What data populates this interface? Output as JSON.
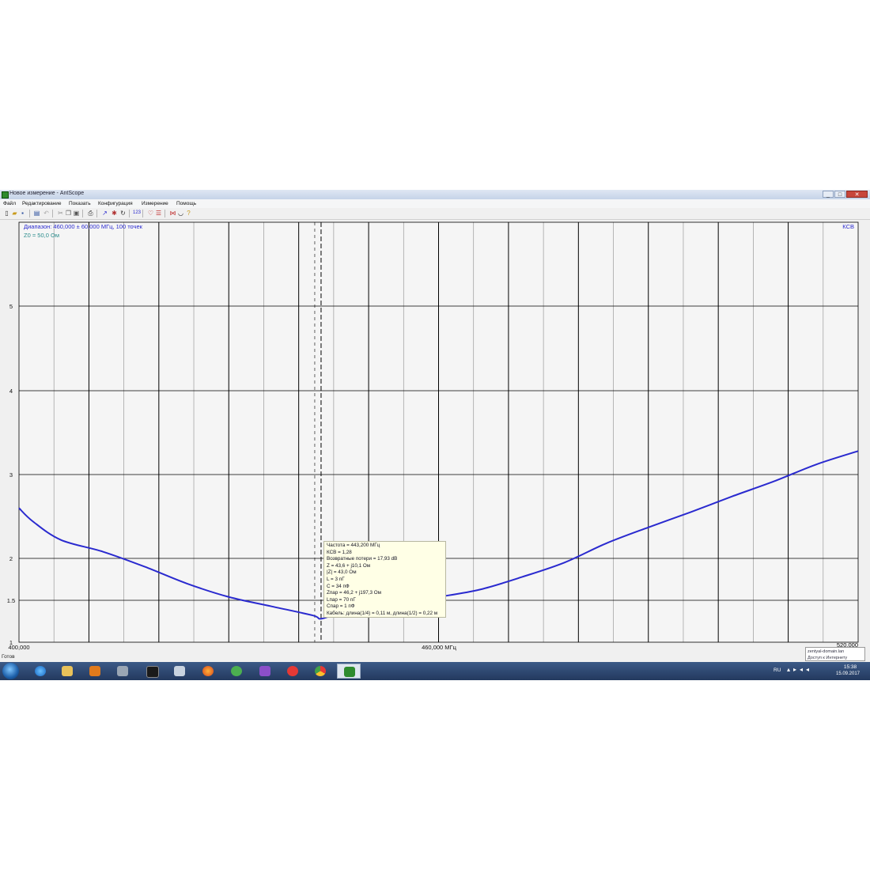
{
  "window": {
    "title": "Новое измерение - AntScope",
    "controls": [
      "_",
      "□",
      "✕"
    ]
  },
  "menu": [
    "Файл",
    "Редактирование",
    "Показать",
    "Конфигурация",
    "Измерение",
    "Помощь"
  ],
  "chart": {
    "range_label": "Диапазон: 460,000 ± 60,000 МГц, 100 точек",
    "z0_label": "Z0 = 50,0 Ом",
    "series_label": "КСВ",
    "x_start_label": "400,000",
    "x_center_label": "460,000 МГц",
    "x_end_label": "520,000",
    "colors": {
      "curve": "#2a2acf",
      "grid_major": "#000000",
      "grid_minor": "#9a9a9a",
      "plot_bg": "#f5f5f5",
      "label_blue": "#2a2acf",
      "label_teal": "#2a8c8c"
    }
  },
  "chart_data": {
    "type": "line",
    "title": "",
    "xlabel": "МГц",
    "ylabel": "",
    "xlim": [
      400,
      520
    ],
    "y_ticks": [
      {
        "label": "1",
        "value": 1
      },
      {
        "label": "1.5",
        "value": 1.5
      },
      {
        "label": "2",
        "value": 2
      },
      {
        "label": "3",
        "value": 3
      },
      {
        "label": "4",
        "value": 4
      },
      {
        "label": "5",
        "value": 5
      }
    ],
    "x_tick_labels": [
      "400,000",
      "460,000 МГц"
    ],
    "series": [
      {
        "name": "КСВ",
        "x": [
          400,
          402,
          406,
          412,
          418,
          424,
          430,
          436,
          442,
          443.2,
          446,
          452,
          460,
          466,
          472,
          478,
          484,
          490,
          496,
          502,
          508,
          514,
          520
        ],
        "values": [
          2.6,
          2.44,
          2.22,
          2.08,
          1.9,
          1.7,
          1.54,
          1.43,
          1.32,
          1.28,
          1.35,
          1.44,
          1.54,
          1.63,
          1.78,
          1.95,
          2.18,
          2.37,
          2.55,
          2.74,
          2.92,
          3.12,
          3.28
        ]
      }
    ],
    "marker": {
      "x": 443.2,
      "lines": [
        "Частота = 443,200 МГц",
        "КСВ = 1,28",
        "Возвратные потери = 17,93 dB",
        "Z = 43,6 + j10,1 Ом",
        "|Z| = 43,0 Ом",
        "L = 3 nГ",
        "C = 34 пФ",
        "Zпар = 46,2 + j197,3 Ом",
        "Lпар = 70 nГ",
        "Cпар = 1 пФ",
        "Кабель: длина(1/4) = 0,11 м, длина(1/2) = 0,22 м"
      ]
    },
    "grid": true,
    "legend": "top-right"
  },
  "status": {
    "text": "Готов"
  },
  "notification": {
    "line1": "zentyal-domain.lan",
    "line2": "Доступ к Интернету"
  },
  "taskbar": {
    "apps": [
      "start",
      "internet-explorer",
      "file-explorer",
      "media-player",
      "vmware",
      "terminal",
      "calculator",
      "firefox",
      "ccleaner",
      "visual-studio",
      "yandex-browser",
      "chrome",
      "antscope"
    ],
    "lang": "RU",
    "time": "15:38",
    "date": "15.09.2017"
  }
}
